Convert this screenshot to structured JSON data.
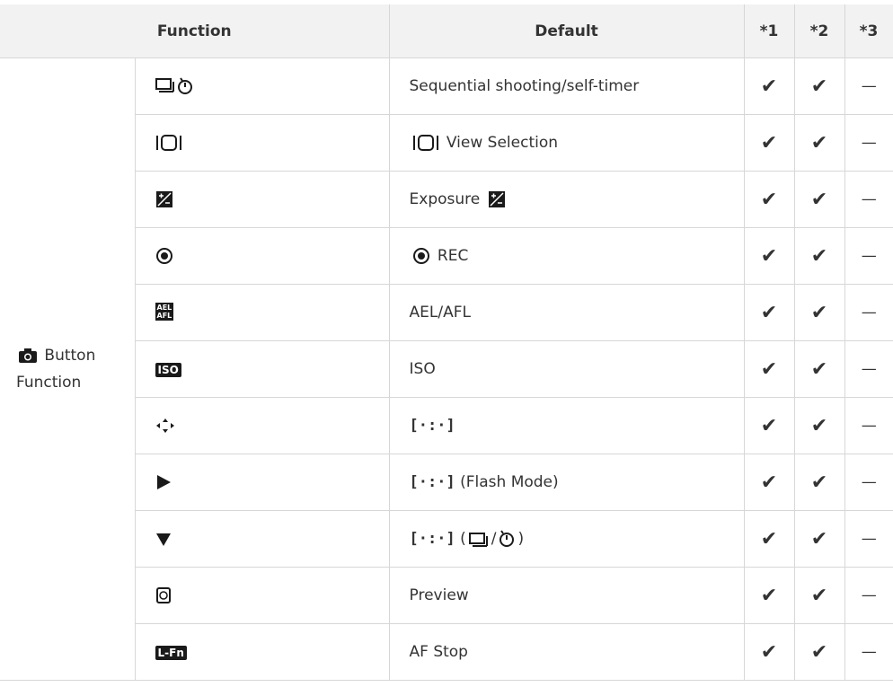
{
  "header": {
    "function": "Function",
    "default": "Default",
    "c1": "*1",
    "c2": "*2",
    "c3": "*3"
  },
  "group_label_line1": "Button",
  "group_label_line2": "Function",
  "check": "✔",
  "dash": "—",
  "rows": [
    {
      "icon": "sequential-self-timer-icon",
      "default_text": "Sequential shooting/self-timer"
    },
    {
      "icon": "view-selection-icon",
      "default_text": "View Selection"
    },
    {
      "icon": "exposure-compensation-icon",
      "default_text": "Exposure"
    },
    {
      "icon": "record-icon",
      "default_text": "REC"
    },
    {
      "icon": "ael-afl-icon",
      "default_text": "AEL/AFL"
    },
    {
      "icon": "iso-icon",
      "default_text": "ISO"
    },
    {
      "icon": "arrow-pad-icon",
      "default_text": ""
    },
    {
      "icon": "right-arrow-icon",
      "default_text": "(Flash Mode)"
    },
    {
      "icon": "down-arrow-icon",
      "default_text": "("
    },
    {
      "icon": "preview-icon",
      "default_text": "Preview"
    },
    {
      "icon": "l-fn-icon",
      "default_text": "AF Stop"
    }
  ],
  "icons": {
    "iso_label": "ISO",
    "lfn_label": "L-Fn",
    "ael_label": "AEL",
    "afl_label": "AFL"
  },
  "misc": {
    "close_paren": ")",
    "slash": "/",
    "bracket_sym": "[·:·]"
  }
}
